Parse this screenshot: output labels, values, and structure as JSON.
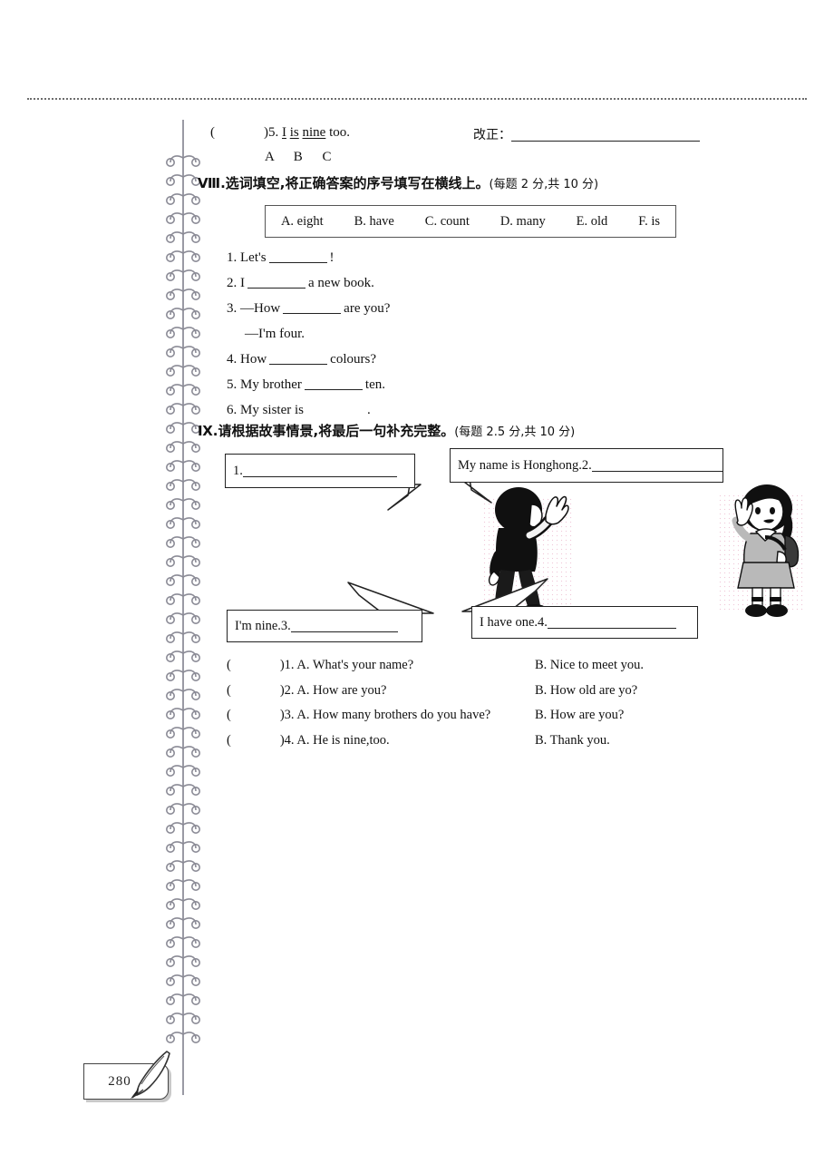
{
  "page": {
    "number": "280",
    "quill_icon": "quill-pen-icon",
    "binding_icon": "spiral-binding-icon"
  },
  "question5": {
    "paren": "(",
    "paren_close": ")",
    "number": "5.",
    "word_a": "I",
    "word_is": "is",
    "word_nine": "nine",
    "word_too": "too.",
    "options_row": "A  B   C",
    "correction_label": "改正："
  },
  "section8": {
    "numeral": "Ⅷ.",
    "title": "选词填空,将正确答案的序号填写在横线上。",
    "score": "(每题 2 分,共 10 分)",
    "word_bank": [
      "A. eight",
      "B. have",
      "C. count",
      "D. many",
      "E. old",
      "F. is"
    ],
    "items": [
      {
        "num": "1.",
        "before": "Let's",
        "after": "!"
      },
      {
        "num": "2.",
        "before": "I",
        "after": "a new book."
      },
      {
        "num": "3.",
        "before": "—How",
        "after": "are you?"
      },
      {
        "num": "",
        "before": "—I'm four.",
        "after": ""
      },
      {
        "num": "4.",
        "before": "How",
        "after": "colours?"
      },
      {
        "num": "5.",
        "before": "My brother",
        "after": "ten."
      },
      {
        "num": "6.",
        "before": "My sister is",
        "after": "."
      }
    ]
  },
  "section9": {
    "numeral": "Ⅸ.",
    "title": "请根据故事情景,将最后一句补充完整。",
    "score": "(每题 2.5 分,共 10 分)",
    "bubbles": {
      "b1": {
        "text": "1.",
        "figure": "boy-waving-illustration"
      },
      "b2": {
        "text": "My name is Honghong.2."
      },
      "b3": {
        "text": "I'm nine.3."
      },
      "b4": {
        "text": "I have one.4."
      }
    },
    "choices": [
      {
        "paren": "(",
        "paren_close": ")",
        "num": "1.",
        "a": "A. What's your name?",
        "b": "B. Nice to meet you."
      },
      {
        "paren": "(",
        "paren_close": ")",
        "num": "2.",
        "a": "A. How are you?",
        "b": "B. How old are yo?"
      },
      {
        "paren": "(",
        "paren_close": ")",
        "num": "3.",
        "a": "A. How many brothers do you have?",
        "b": "B. How are you?"
      },
      {
        "paren": "(",
        "paren_close": ")",
        "num": "4.",
        "a": "A. He is nine,too.",
        "b": "B. Thank you."
      }
    ]
  }
}
